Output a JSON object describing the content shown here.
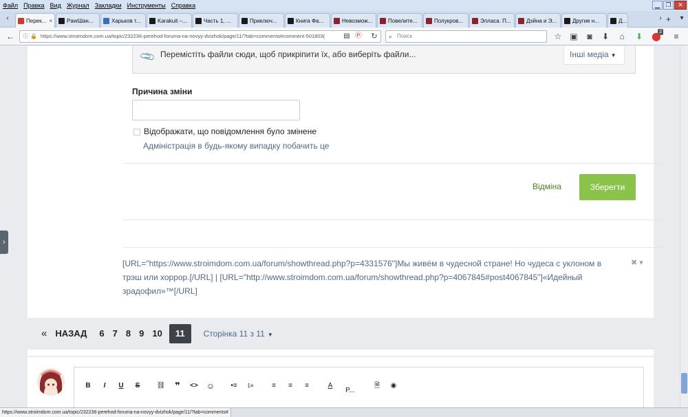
{
  "menu": [
    "Файл",
    "Правка",
    "Вид",
    "Журнал",
    "Закладки",
    "Инструменты",
    "Справка"
  ],
  "tabs": [
    {
      "label": "Перек...",
      "color": "#c83a2a",
      "active": true
    },
    {
      "label": "PawШан...",
      "color": "#1a1a1a"
    },
    {
      "label": "Харьков т...",
      "color": "#3a6fbf"
    },
    {
      "label": "Karakuit –...",
      "color": "#1a1a1a"
    },
    {
      "label": "Часть 1, ...",
      "color": "#1a1a1a"
    },
    {
      "label": "Приключ...",
      "color": "#1a1a1a"
    },
    {
      "label": "Книга Фа...",
      "color": "#1a1a1a"
    },
    {
      "label": "Невозмож...",
      "color": "#8a2230"
    },
    {
      "label": "Повелите...",
      "color": "#8a2230"
    },
    {
      "label": "Полукров...",
      "color": "#8a2230"
    },
    {
      "label": "Элласа. П...",
      "color": "#8a2230"
    },
    {
      "label": "Дэйна и Э...",
      "color": "#8a2230"
    },
    {
      "label": "Другие н...",
      "color": "#1a1a1a"
    },
    {
      "label": "Д...",
      "color": "#1a1a1a"
    }
  ],
  "nav": {
    "url": "https://www.stroimdom.com.ua/topic/232236-perehod-foruma-na-novyy-dvizhok/page/11/?tab=comments#comment-501803(",
    "search_placeholder": "Поиск",
    "badge": "2"
  },
  "upload": {
    "drop_text": "Перемістіть файли сюди, щоб прикріпити їх, або виберіть файли...",
    "other_media": "Інші медіа"
  },
  "form": {
    "reason_label": "Причина зміни",
    "reason_value": "",
    "show_edited_label": "Відображати, що повідомлення було змінене",
    "show_edited_hint": "Адміністрація в будь-якому випадку побачить це",
    "cancel": "Відміна",
    "save": "Зберегти"
  },
  "signature": "[URL=\"https://www.stroimdom.com.ua/forum/showthread.php?p=4331576\"]Мы живём в чудесной стране! Но чудеса с уклоном в трэш или хоррор.[/URL] | [URL=\"http://www.stroimdom.com.ua/forum/showthread.php?p=4067845#post4067845\"]«Идейный зрадофил»™[/URL]",
  "pagination": {
    "prev_symbol": "«",
    "back": "НАЗАД",
    "pages": [
      "6",
      "7",
      "8",
      "9",
      "10"
    ],
    "current": "11",
    "info": "Сторінка 11 з 11"
  },
  "editor_toolbar": [
    "B",
    "I",
    "U",
    "S",
    "🔗",
    "‚‚",
    "<>",
    "☺",
    "•≡",
    "1≡",
    "≡",
    "≡",
    "≡",
    "A",
    "P...",
    "🔍",
    "👁"
  ],
  "status_url": "https://www.stroimdom.com.ua/topic/232236-perehod-foruma-na-novyy-dvizhok/page/11/?tab=comments#"
}
